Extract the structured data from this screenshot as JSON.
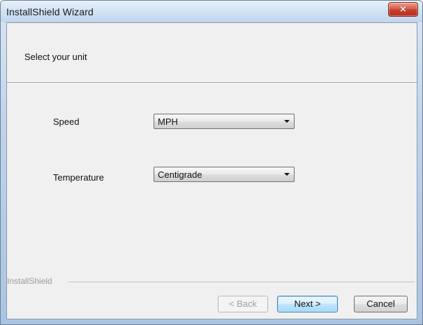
{
  "window": {
    "title": "InstallShield Wizard",
    "close_icon": "×"
  },
  "header": {
    "title": "Select your unit"
  },
  "fields": {
    "speed": {
      "label": "Speed",
      "selected_value": "MPH"
    },
    "temperature": {
      "label": "Temperature",
      "selected_value": "Centigrade"
    }
  },
  "footer": {
    "brand": "InstallShield",
    "back_label": "< Back",
    "next_label": "Next >",
    "cancel_label": "Cancel"
  },
  "colors": {
    "title_bar": "#c0d5ec",
    "close_button": "#c93f2b",
    "dialog_background": "#f0f0f0",
    "default_button": "#a7d9f5"
  },
  "icons": {
    "close": "close-icon",
    "dropdown": "chevron-down-icon"
  }
}
